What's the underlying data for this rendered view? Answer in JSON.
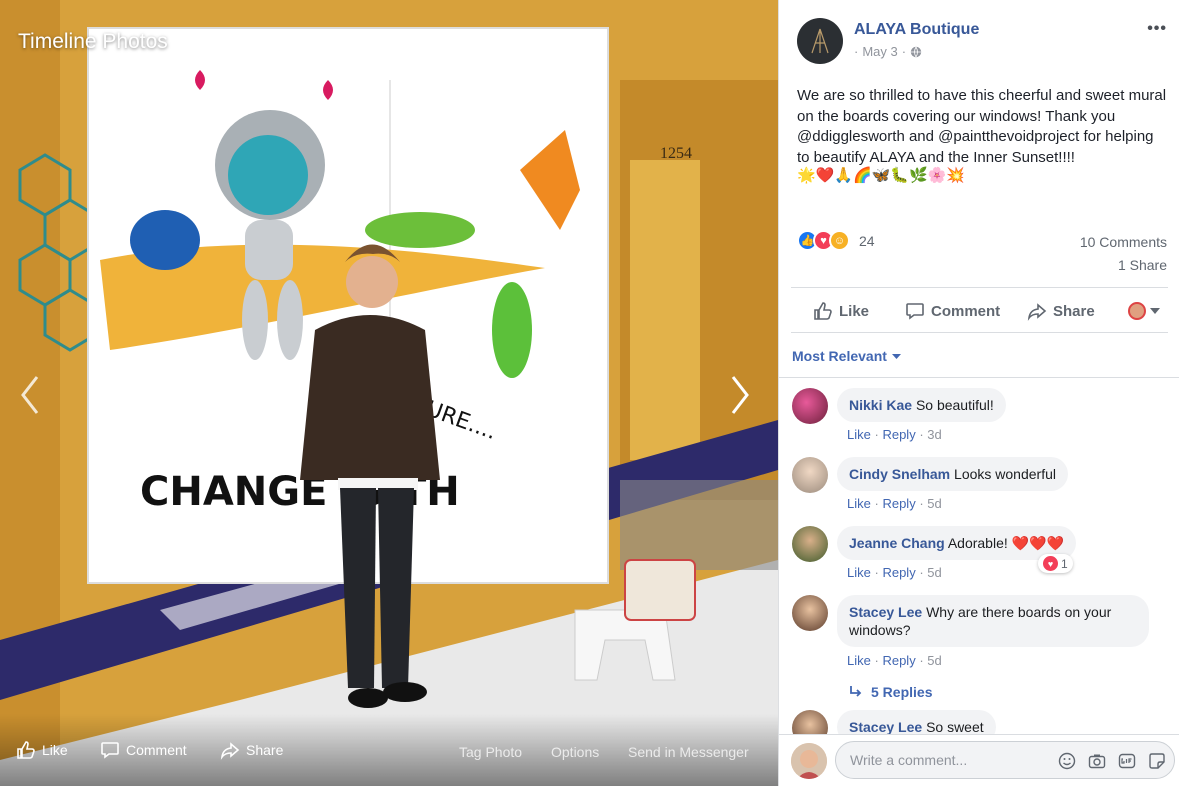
{
  "viewer": {
    "title": "Timeline Photos",
    "photo_text": "CHANGE IS TH",
    "photo_text_2": "TURE....",
    "house_number": "1254",
    "actions": {
      "like": "Like",
      "comment": "Comment",
      "share": "Share",
      "tag": "Tag Photo",
      "options": "Options",
      "messenger": "Send in Messenger"
    },
    "icons": {
      "prev": "chevron-left-icon",
      "next": "chevron-right-icon"
    }
  },
  "post": {
    "page_name": "ALAYA Boutique",
    "date": "May 3",
    "privacy_icon": "globe-icon",
    "text": "We are so thrilled to have this cheerful and sweet mural on the boards covering our windows! Thank you @ddigglesworth and @paintthevoidproject for helping to beautify ALAYA and the Inner Sunset!!!!",
    "emojis": "🌟❤️🙏🌈🦋🐛🌿🌸💥",
    "reaction_count": "24",
    "comments_count": "10 Comments",
    "shares_count": "1 Share",
    "actions": {
      "like": "Like",
      "comment": "Comment",
      "share": "Share"
    },
    "colors": {
      "link": "#385898",
      "accent": "#4267b2",
      "love": "#f33e58",
      "haha": "#f7b125"
    }
  },
  "comments_section": {
    "sort_label": "Most Relevant",
    "items": [
      {
        "author": "Nikki Kae",
        "text": "So beautiful!",
        "like": "Like",
        "reply": "Reply",
        "time": "3d"
      },
      {
        "author": "Cindy Snelham",
        "text": "Looks wonderful",
        "like": "Like",
        "reply": "Reply",
        "time": "5d"
      },
      {
        "author": "Jeanne Chang",
        "text": "Adorable! ❤️❤️❤️",
        "like": "Like",
        "reply": "Reply",
        "time": "5d",
        "reaction_count": "1"
      },
      {
        "author": "Stacey Lee",
        "text": "Why are there boards on your windows?",
        "like": "Like",
        "reply": "Reply",
        "time": "5d"
      },
      {
        "author": "Stacey Lee",
        "text": "So sweet"
      }
    ],
    "replies_label": "5 Replies",
    "composer_placeholder": "Write a comment..."
  }
}
